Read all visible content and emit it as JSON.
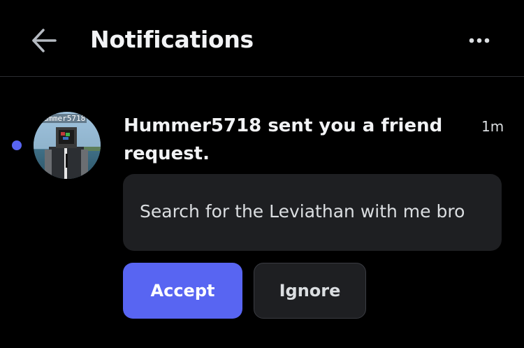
{
  "header": {
    "title": "Notifications",
    "back_icon": "arrow-left-icon",
    "more_icon": "more-horizontal-icon"
  },
  "notification": {
    "unread": true,
    "avatar_overlay_text": "Hummer5718",
    "text": "Hummer5718 sent you a friend request.",
    "timestamp": "1m",
    "message": "Search for the Leviathan with me bro",
    "accept_label": "Accept",
    "ignore_label": "Ignore"
  },
  "colors": {
    "background": "#000000",
    "accent": "#5865f2",
    "card": "#1e1f22",
    "divider": "#2b2d31",
    "text_primary": "#f2f3f5",
    "text_secondary": "#dbdee1"
  }
}
